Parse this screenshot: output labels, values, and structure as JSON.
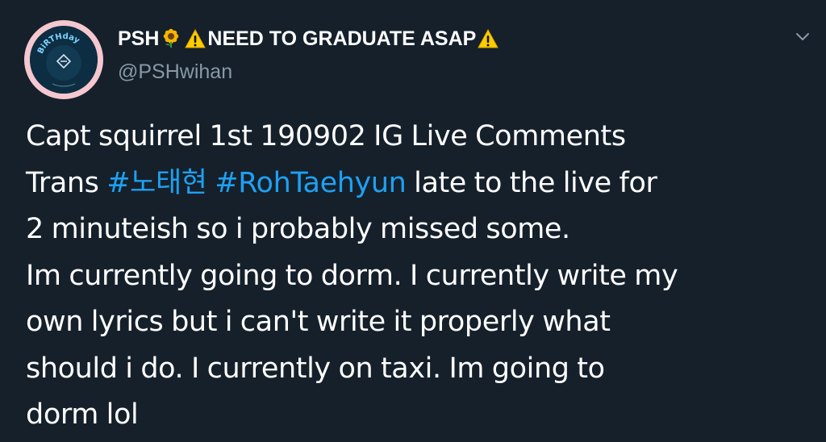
{
  "user": {
    "display_name_prefix": "PSH",
    "display_name_main": "NEED TO GRADUATE ASAP",
    "handle": "@PSHwihan",
    "avatar_text": "BiRTHday"
  },
  "icons": {
    "name_emoji_1": "sunflower-icon",
    "name_emoji_2": "warning-icon",
    "name_emoji_3": "warning-icon",
    "menu": "chevron-down-icon"
  },
  "colors": {
    "background": "#15202b",
    "text": "#ffffff",
    "secondary_text": "#8899a6",
    "hashtag": "#1da1f2",
    "avatar_ring": "#f5c7cf"
  },
  "tweet": {
    "line1": "Capt squirrel 1st 190902 IG Live Comments",
    "line2_pre": "Trans ",
    "hashtag1": "#노태현",
    "hashtag2": "#RohTaehyun",
    "line2_post": " late to the live for",
    "line3": "2 minuteish so i probably missed some.",
    "line4": "Im currently going to dorm. I currently write my",
    "line5": "own lyrics but i can't write it properly what",
    "line6": "should i do. I currently on taxi. Im going to",
    "line7": "dorm lol"
  }
}
